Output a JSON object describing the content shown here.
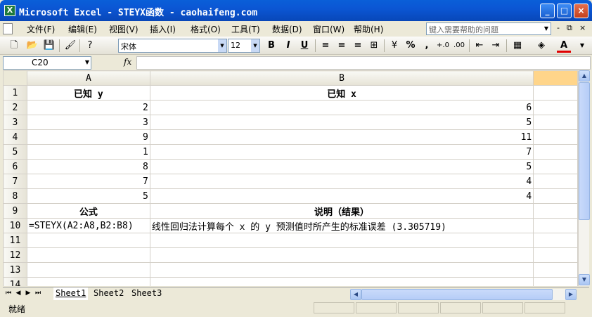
{
  "window": {
    "title": "Microsoft Excel - STEYX函数 - caohaifeng.com",
    "icon": "X",
    "min_label": "_",
    "max_label": "□",
    "close_label": "×"
  },
  "menubar": {
    "items": [
      "文件(F)",
      "编辑(E)",
      "视图(V)",
      "插入(I)",
      "格式(O)",
      "工具(T)",
      "数据(D)",
      "窗口(W)",
      "帮助(H)"
    ],
    "help_placeholder": "键入需要帮助的问题",
    "mdi_buttons": [
      "-",
      "⧉",
      "×"
    ]
  },
  "toolbar": {
    "font_name": "宋体",
    "font_size": "12",
    "bold": "B",
    "italic": "I",
    "underline": "U",
    "percent": "%",
    "comma": ",",
    "font_color_letter": "A"
  },
  "formula_bar": {
    "name_box": "C20",
    "fx_label": "fx",
    "formula": ""
  },
  "sheet": {
    "column_headers": [
      "A",
      "B",
      ""
    ],
    "rows": [
      {
        "n": "1",
        "a": "已知 y",
        "b": "已知 x"
      },
      {
        "n": "2",
        "a": "2",
        "b": "6"
      },
      {
        "n": "3",
        "a": "3",
        "b": "5"
      },
      {
        "n": "4",
        "a": "9",
        "b": "11"
      },
      {
        "n": "5",
        "a": "1",
        "b": "7"
      },
      {
        "n": "6",
        "a": "8",
        "b": "5"
      },
      {
        "n": "7",
        "a": "7",
        "b": "4"
      },
      {
        "n": "8",
        "a": "5",
        "b": "4"
      },
      {
        "n": "9",
        "a": "公式",
        "b": "说明（结果）"
      },
      {
        "n": "10",
        "a": "=STEYX(A2:A8,B2:B8)",
        "b": "线性回归法计算每个 x 的 y 预测值时所产生的标准误差 (3.305719)"
      },
      {
        "n": "11",
        "a": "",
        "b": ""
      },
      {
        "n": "12",
        "a": "",
        "b": ""
      },
      {
        "n": "13",
        "a": "",
        "b": ""
      },
      {
        "n": "14",
        "a": "",
        "b": ""
      }
    ]
  },
  "tabs": {
    "sheets": [
      "Sheet1",
      "Sheet2",
      "Sheet3"
    ],
    "active": "Sheet1"
  },
  "status": {
    "text": "就绪"
  }
}
